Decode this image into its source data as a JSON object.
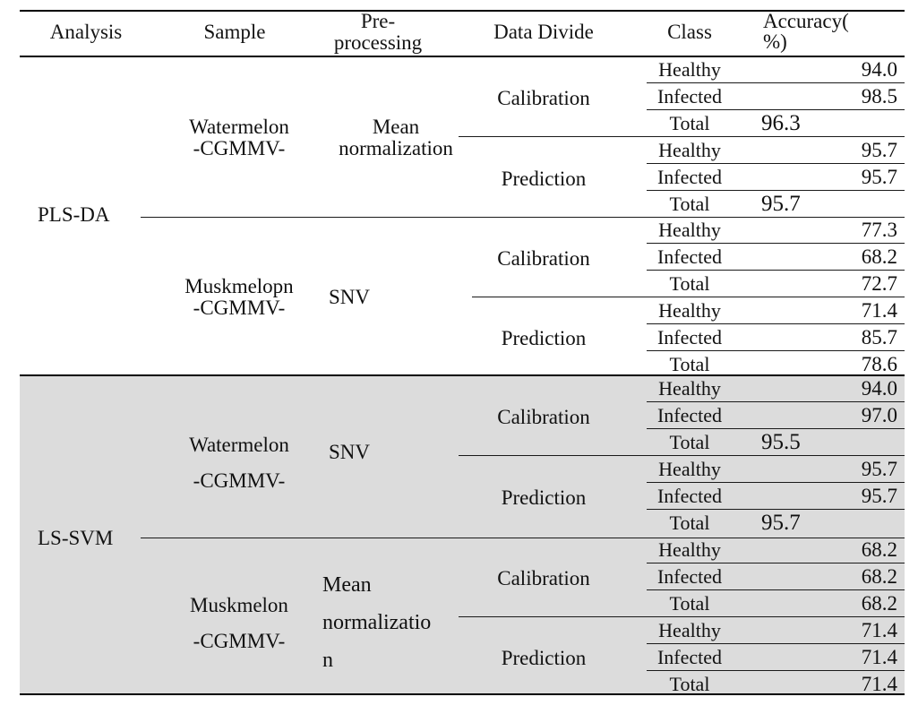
{
  "table": {
    "headers": {
      "analysis": "Analysis",
      "sample": "Sample",
      "preprocessing": "Pre-\nprocessing",
      "data_divide": "Data Divide",
      "class": "Class",
      "accuracy": "Accuracy(\n%)"
    },
    "sections": [
      {
        "analysis": "PLS-DA",
        "shaded": false,
        "blocks": [
          {
            "sample": "Watermelon\n-CGMMV-",
            "preprocessing": "Mean\nnormalization",
            "divides": [
              {
                "name": "Calibration",
                "rows": [
                  {
                    "class": "Healthy",
                    "accuracy": "94.0"
                  },
                  {
                    "class": "Infected",
                    "accuracy": "98.5"
                  },
                  {
                    "class": "Total",
                    "accuracy": "96.3"
                  }
                ]
              },
              {
                "name": "Prediction",
                "rows": [
                  {
                    "class": "Healthy",
                    "accuracy": "95.7"
                  },
                  {
                    "class": "Infected",
                    "accuracy": "95.7"
                  },
                  {
                    "class": "Total",
                    "accuracy": "95.7"
                  }
                ]
              }
            ]
          },
          {
            "sample": "Muskmelopn\n-CGMMV-",
            "preprocessing": "SNV",
            "divides": [
              {
                "name": "Calibration",
                "rows": [
                  {
                    "class": "Healthy",
                    "accuracy": "77.3"
                  },
                  {
                    "class": "Infected",
                    "accuracy": "68.2"
                  },
                  {
                    "class": "Total",
                    "accuracy": "72.7"
                  }
                ]
              },
              {
                "name": "Prediction",
                "rows": [
                  {
                    "class": "Healthy",
                    "accuracy": "71.4"
                  },
                  {
                    "class": "Infected",
                    "accuracy": "85.7"
                  },
                  {
                    "class": "Total",
                    "accuracy": "78.6"
                  }
                ]
              }
            ]
          }
        ]
      },
      {
        "analysis": "LS-SVM",
        "shaded": true,
        "blocks": [
          {
            "sample": "Watermelon\n-CGMMV-",
            "preprocessing": "SNV",
            "divides": [
              {
                "name": "Calibration",
                "rows": [
                  {
                    "class": "Healthy",
                    "accuracy": "94.0"
                  },
                  {
                    "class": "Infected",
                    "accuracy": "97.0"
                  },
                  {
                    "class": "Total",
                    "accuracy": "95.5"
                  }
                ]
              },
              {
                "name": "Prediction",
                "rows": [
                  {
                    "class": "Healthy",
                    "accuracy": "95.7"
                  },
                  {
                    "class": "Infected",
                    "accuracy": "95.7"
                  },
                  {
                    "class": "Total",
                    "accuracy": "95.7"
                  }
                ]
              }
            ]
          },
          {
            "sample": "Muskmelon\n-CGMMV-",
            "preprocessing": "Mean\nnormalizatio\nn",
            "divides": [
              {
                "name": "Calibration",
                "rows": [
                  {
                    "class": "Healthy",
                    "accuracy": "68.2"
                  },
                  {
                    "class": "Infected",
                    "accuracy": "68.2"
                  },
                  {
                    "class": "Total",
                    "accuracy": "68.2"
                  }
                ]
              },
              {
                "name": "Prediction",
                "rows": [
                  {
                    "class": "Healthy",
                    "accuracy": "71.4"
                  },
                  {
                    "class": "Infected",
                    "accuracy": "71.4"
                  },
                  {
                    "class": "Total",
                    "accuracy": "71.4"
                  }
                ]
              }
            ]
          }
        ]
      }
    ],
    "colors": {
      "shade": "#dcdcdc",
      "rule": "#000000",
      "text": "#111111"
    }
  }
}
